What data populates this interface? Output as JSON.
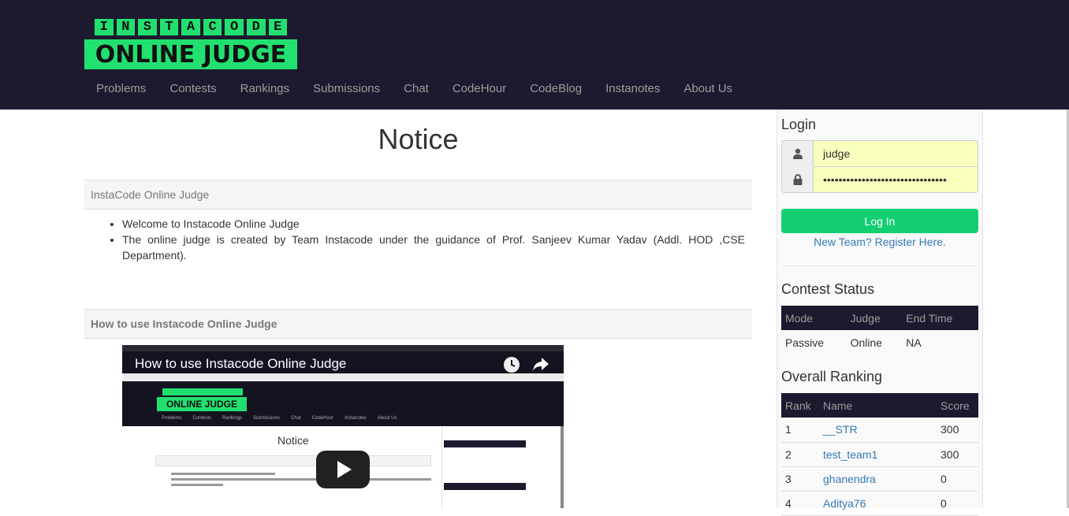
{
  "header": {
    "logo": {
      "top_letters": [
        "I",
        "N",
        "S",
        "T",
        "A",
        "C",
        "O",
        "D",
        "E"
      ],
      "bottom_text": "ONLINE JUDGE"
    },
    "nav": [
      {
        "label": "Problems"
      },
      {
        "label": "Contests"
      },
      {
        "label": "Rankings"
      },
      {
        "label": "Submissions"
      },
      {
        "label": "Chat"
      },
      {
        "label": "CodeHour"
      },
      {
        "label": "CodeBlog"
      },
      {
        "label": "Instanotes"
      },
      {
        "label": "About Us"
      }
    ]
  },
  "main": {
    "title": "Notice",
    "panel1_heading": "InstaCode Online Judge",
    "notices": [
      "Welcome to Instacode Online Judge",
      "The online judge is created by Team Instacode under the guidance of Prof. Sanjeev Kumar Yadav (Addl. HOD ,CSE Department)."
    ],
    "panel2_heading": "How to use Instacode Online Judge",
    "video": {
      "title": "How to use Instacode Online Judge",
      "inner_notice": "Notice"
    }
  },
  "sidebar": {
    "login": {
      "heading": "Login",
      "username_value": "judge",
      "password_value": "••••••••••••••••••••••••••••••••",
      "button_label": "Log In",
      "register_link": "New Team? Register Here."
    },
    "contest_status": {
      "heading": "Contest Status",
      "columns": [
        "Mode",
        "Judge",
        "End Time"
      ],
      "row": [
        "Passive",
        "Online",
        "NA"
      ]
    },
    "overall_ranking": {
      "heading": "Overall Ranking",
      "columns": [
        "Rank",
        "Name",
        "Score"
      ],
      "rows": [
        [
          "1",
          "__STR",
          "300"
        ],
        [
          "2",
          "test_team1",
          "300"
        ],
        [
          "3",
          "ghanendra",
          "0"
        ],
        [
          "4",
          "Aditya76",
          "0"
        ]
      ]
    }
  },
  "colors": {
    "header_bg": "#1b1a2e",
    "logo_green": "#22e070",
    "button_green": "#13cf71",
    "link_blue": "#337ab7",
    "autofill_yellow": "#faffbd"
  }
}
